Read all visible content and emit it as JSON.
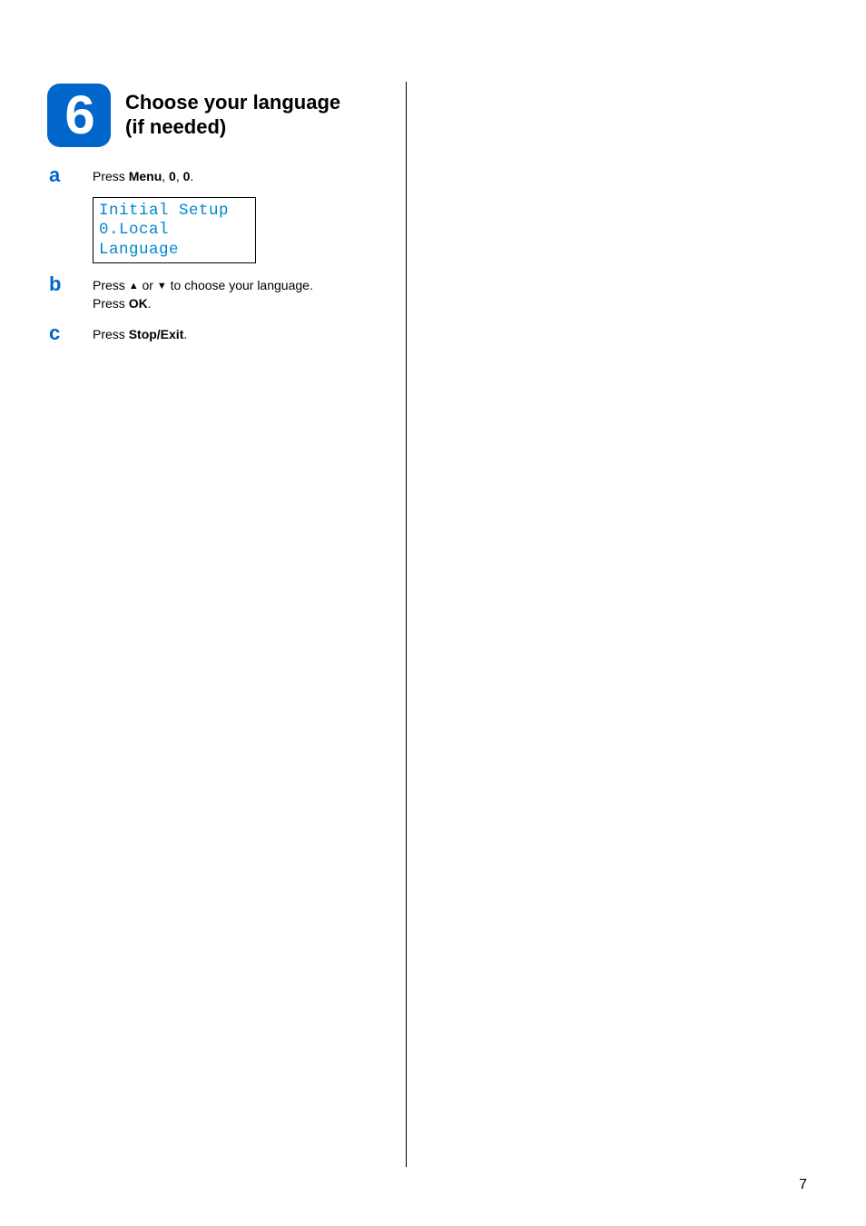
{
  "step_number": "6",
  "step_title_line1": "Choose your language",
  "step_title_line2": "(if needed)",
  "substeps": {
    "a": {
      "letter": "a",
      "prefix": "Press ",
      "bold1": "Menu",
      "mid1": ", ",
      "bold2": "0",
      "mid2": ", ",
      "bold3": "0",
      "suffix": "."
    },
    "b": {
      "letter": "b",
      "prefix": "Press ",
      "arrow_up": "▲",
      "mid1": " or ",
      "arrow_down": "▼",
      "mid2": " to choose your language.",
      "line2_prefix": "Press ",
      "line2_bold": "OK",
      "line2_suffix": "."
    },
    "c": {
      "letter": "c",
      "prefix": "Press ",
      "bold1": "Stop/Exit",
      "suffix": "."
    }
  },
  "lcd": {
    "line1": "Initial Setup",
    "line2": "0.Local Language"
  },
  "page_number": "7"
}
